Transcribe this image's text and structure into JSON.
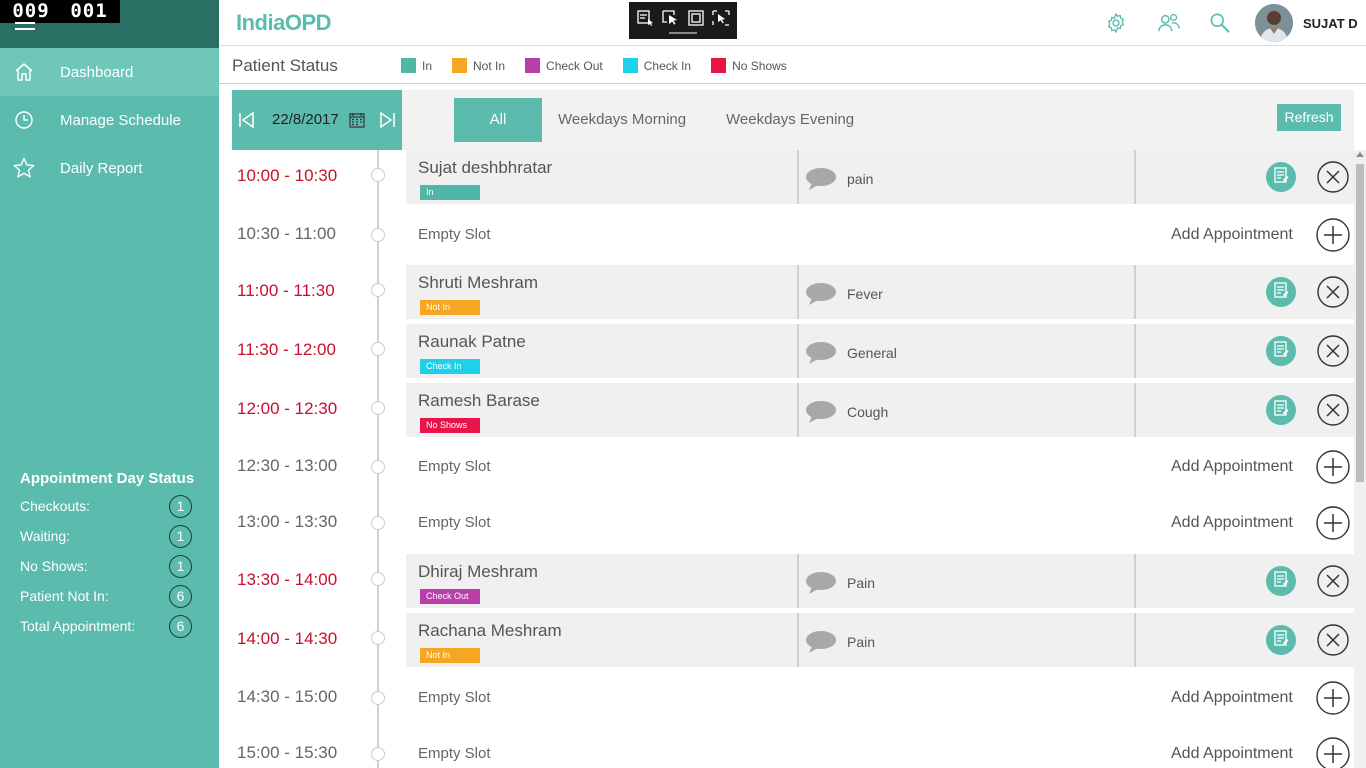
{
  "counter": {
    "left": "009",
    "right": "001"
  },
  "app": {
    "logo": "IndiaOPD",
    "user": "SUJAT D"
  },
  "sidebar": {
    "items": [
      {
        "label": "Dashboard",
        "icon": "home-icon",
        "active": true
      },
      {
        "label": "Manage Schedule",
        "icon": "clock-icon",
        "active": false
      },
      {
        "label": "Daily Report",
        "icon": "star-icon",
        "active": false
      }
    ],
    "day_status": {
      "title": "Appointment Day Status",
      "rows": [
        {
          "label": "Checkouts:",
          "value": "1"
        },
        {
          "label": "Waiting:",
          "value": "1"
        },
        {
          "label": "No Shows:",
          "value": "1"
        },
        {
          "label": "Patient Not In:",
          "value": "6"
        },
        {
          "label": "Total Appointment:",
          "value": "6"
        }
      ]
    }
  },
  "patient_status": {
    "title": "Patient Status",
    "legend": [
      {
        "label": "In",
        "color": "#4fb6a8"
      },
      {
        "label": "Not In",
        "color": "#f5a623"
      },
      {
        "label": "Check Out",
        "color": "#b83fa8"
      },
      {
        "label": "Check In",
        "color": "#1fd0ea"
      },
      {
        "label": "No Shows",
        "color": "#e8154a"
      }
    ]
  },
  "datebar": {
    "date": "22/8/2017"
  },
  "tabs": [
    {
      "label": "All",
      "active": true
    },
    {
      "label": "Weekdays Morning",
      "active": false
    },
    {
      "label": "Weekdays Evening",
      "active": false
    }
  ],
  "refresh_label": "Refresh",
  "empty_label": "Empty Slot",
  "add_label": "Add Appointment",
  "slots": [
    {
      "time": "10:00 - 10:30",
      "booked": true,
      "name": "Sujat deshbhratar",
      "status": "In",
      "status_color": "#4fb6a8",
      "reason": "pain"
    },
    {
      "time": "10:30 - 11:00",
      "booked": false
    },
    {
      "time": "11:00 - 11:30",
      "booked": true,
      "name": "Shruti Meshram",
      "status": "Not In",
      "status_color": "#f5a623",
      "reason": "Fever"
    },
    {
      "time": "11:30 - 12:00",
      "booked": true,
      "name": "Raunak Patne",
      "status": "Check In",
      "status_color": "#1fd0ea",
      "reason": "General"
    },
    {
      "time": "12:00 - 12:30",
      "booked": true,
      "name": "Ramesh Barase",
      "status": "No Shows",
      "status_color": "#e8154a",
      "reason": "Cough"
    },
    {
      "time": "12:30 - 13:00",
      "booked": false
    },
    {
      "time": "13:00 - 13:30",
      "booked": false
    },
    {
      "time": "13:30 - 14:00",
      "booked": true,
      "name": "Dhiraj Meshram",
      "status": "Check Out",
      "status_color": "#b83fa8",
      "reason": "Pain"
    },
    {
      "time": "14:00 - 14:30",
      "booked": true,
      "name": "Rachana Meshram",
      "status": "Not In",
      "status_color": "#f5a623",
      "reason": "Pain"
    },
    {
      "time": "14:30 - 15:00",
      "booked": false
    },
    {
      "time": "15:00 - 15:30",
      "booked": false
    }
  ]
}
